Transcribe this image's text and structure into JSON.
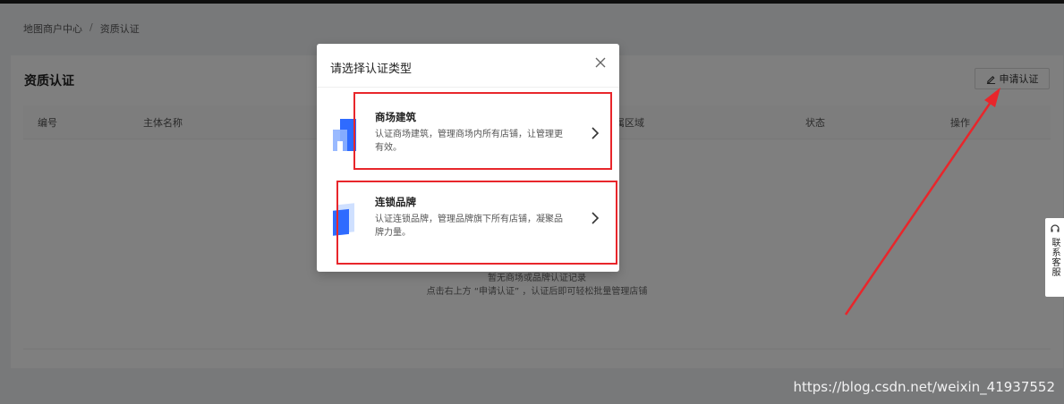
{
  "breadcrumb": {
    "item1": "地图商户中心",
    "separator": "/",
    "item2": "资质认证"
  },
  "page": {
    "title": "资质认证",
    "apply_button": "申请认证",
    "table_headers": [
      "编号",
      "主体名称",
      "所属区域",
      "状态",
      "操作"
    ],
    "empty_line1": "暂无商场或品牌认证记录",
    "empty_line2": "点击右上方 “申请认证” ，认证后即可轻松批量管理店铺"
  },
  "modal": {
    "title": "请选择认证类型",
    "close_icon": "close-icon",
    "options": [
      {
        "title": "商场建筑",
        "desc": "认证商场建筑，管理商场内所有店铺，让管理更有效。",
        "icon": "building-icon"
      },
      {
        "title": "连锁品牌",
        "desc": "认证连锁品牌，管理品牌旗下所有店铺，凝聚品牌力量。",
        "icon": "brand-icon"
      }
    ]
  },
  "side_widget": {
    "label": "联系客服"
  },
  "watermark": "https://blog.csdn.net/weixin_41937552",
  "colors": {
    "highlight": "#e8262b",
    "brand_blue": "#3370ff",
    "mask": "rgba(0,0,0,0.5)"
  }
}
